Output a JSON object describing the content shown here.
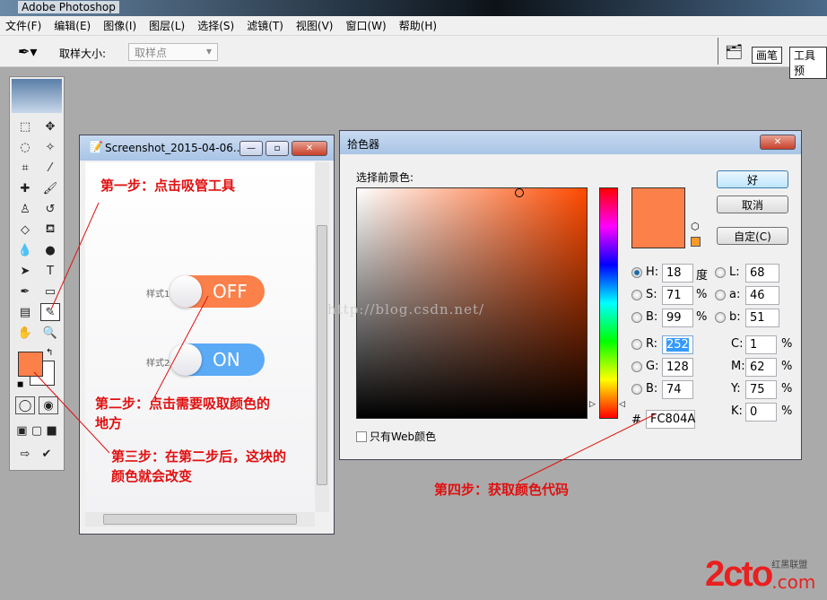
{
  "app": {
    "title": "Adobe Photoshop"
  },
  "menu": [
    "文件(F)",
    "编辑(E)",
    "图像(I)",
    "图层(L)",
    "选择(S)",
    "滤镜(T)",
    "视图(V)",
    "窗口(W)",
    "帮助(H)"
  ],
  "options": {
    "sample_size_label": "取样大小:",
    "sample_size_value": "取样点",
    "tabs": [
      "画笔",
      "工具预"
    ]
  },
  "colors": {
    "foreground": "#FC804A",
    "toggle_on": "#5aaaf6"
  },
  "doc_window": {
    "title": "Screenshot_2015-04-06...",
    "toggles": [
      {
        "label": "样式1",
        "state": "OFF"
      },
      {
        "label": "样式2",
        "state": "ON"
      }
    ]
  },
  "picker": {
    "title": "拾色器",
    "subtitle": "选择前景色:",
    "ok": "好",
    "cancel": "取消",
    "custom": "自定(C)",
    "hsb": [
      {
        "k": "H:",
        "v": "18",
        "u": "度"
      },
      {
        "k": "S:",
        "v": "71",
        "u": "%"
      },
      {
        "k": "B:",
        "v": "99",
        "u": "%"
      }
    ],
    "lab": [
      {
        "k": "L:",
        "v": "68"
      },
      {
        "k": "a:",
        "v": "46"
      },
      {
        "k": "b:",
        "v": "51"
      }
    ],
    "rgb": [
      {
        "k": "R:",
        "v": "252"
      },
      {
        "k": "G:",
        "v": "128"
      },
      {
        "k": "B:",
        "v": "74"
      }
    ],
    "cmyk": [
      {
        "k": "C:",
        "v": "1"
      },
      {
        "k": "M:",
        "v": "62"
      },
      {
        "k": "Y:",
        "v": "75"
      },
      {
        "k": "K:",
        "v": "0"
      }
    ],
    "hash": "#",
    "hex": "FC804A",
    "web_only": "只有Web颜色",
    "percent": "%"
  },
  "annotations": {
    "step1": "第一步：点击吸管工具",
    "step2a": "第二步：点击需要吸取颜色的",
    "step2b": "地方",
    "step3a": "第三步：在第二步后，这块的",
    "step3b": "颜色就会改变",
    "step4": "第四步：获取颜色代码"
  },
  "watermark": "http://blog.csdn.net/",
  "logo": "2cto.com 红黑联盟"
}
